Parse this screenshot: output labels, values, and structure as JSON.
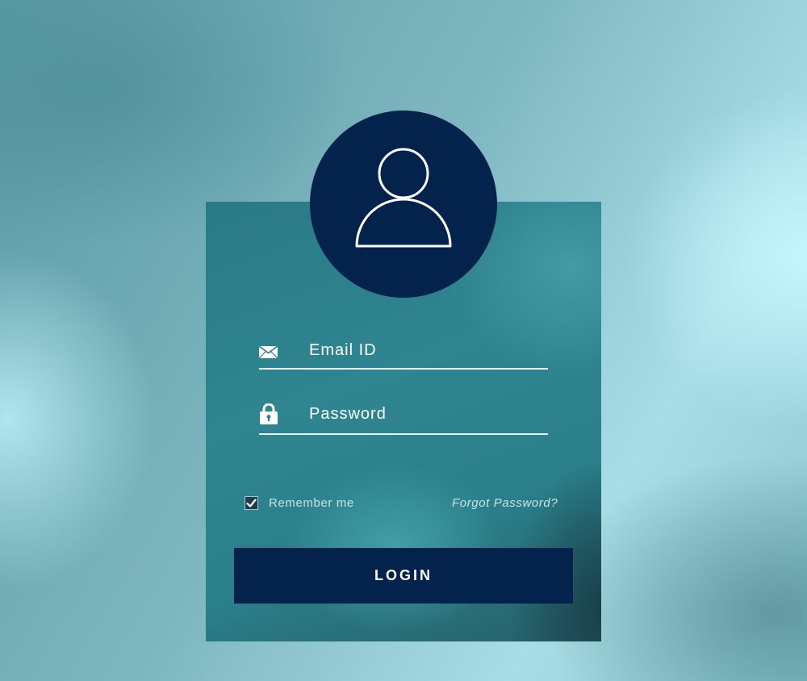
{
  "login_form": {
    "email_label": "Email ID",
    "password_label": "Password",
    "remember_label": "Remember me",
    "remember_checked": true,
    "forgot_label": "Forgot Password?",
    "login_label": "LOGIN"
  },
  "icons": {
    "avatar": "user-icon",
    "email": "envelope-icon",
    "password": "lock-icon",
    "checkbox": "checkmark-icon"
  },
  "colors": {
    "navy": "#03234c",
    "card_teal": "#2f8590",
    "line": "#e8f4f6",
    "muted_text": "#c9e4e7"
  }
}
